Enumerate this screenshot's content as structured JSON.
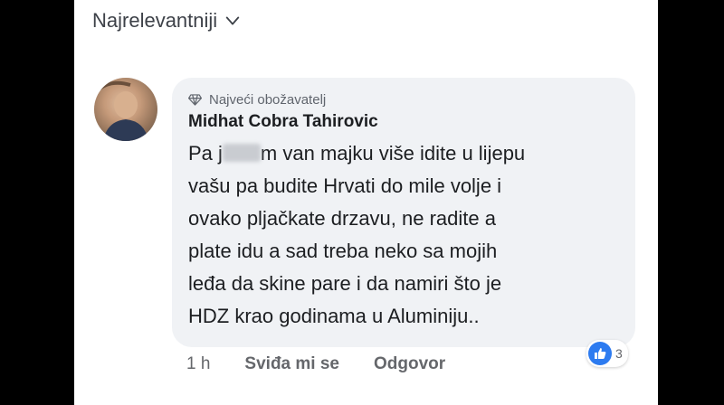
{
  "sort": {
    "label": "Najrelevantniji"
  },
  "comment": {
    "badge": "Najveći obožavatelj",
    "author": "Midhat Cobra Tahirovic",
    "text_lines": [
      {
        "before": "Pa j",
        "after": "m van majku više idite u lijepu"
      },
      "vašu pa budite Hrvati do mile volje i",
      "ovako pljačkate drzavu, ne radite a",
      "plate idu a sad treba neko sa mojih",
      "leđa da skine pare i da namiri što je",
      "HDZ krao godinama u Aluminiju.."
    ],
    "time": "1 h",
    "like_action": "Sviđa mi se",
    "reply_action": "Odgovor",
    "reaction_count": "3"
  },
  "colors": {
    "like_blue": "#2d7bf0",
    "bubble_bg": "#f0f2f5"
  }
}
